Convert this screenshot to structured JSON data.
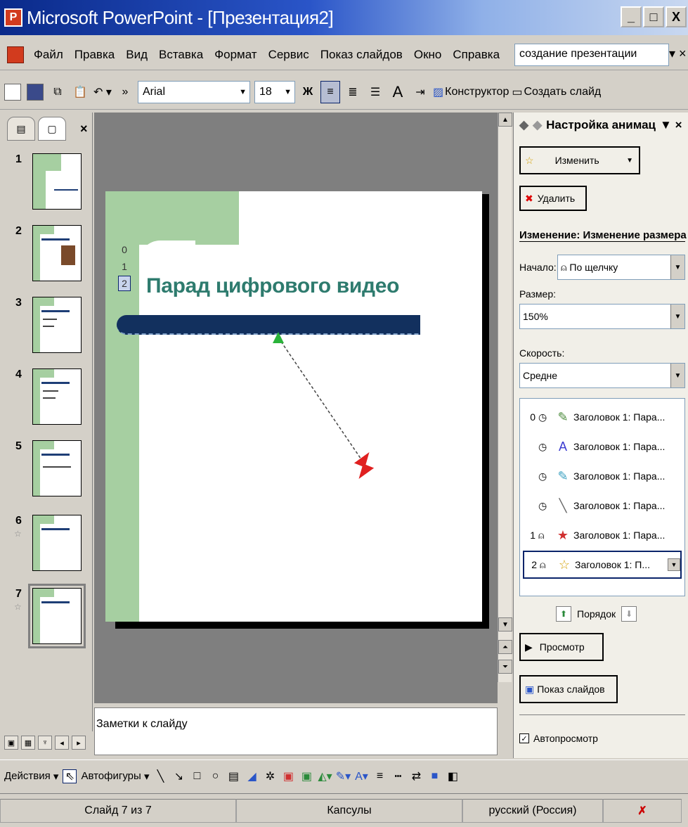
{
  "titlebar": {
    "title": "Microsoft PowerPoint - [Презентация2]",
    "minimize": "_",
    "maximize": "□",
    "close": "X"
  },
  "menu": {
    "items": [
      "Файл",
      "Правка",
      "Вид",
      "Вставка",
      "Формат",
      "Сервис",
      "Показ слайдов",
      "Окно",
      "Справка"
    ],
    "help_box": "создание презентации",
    "help_close": "▾ ×"
  },
  "toolbar": {
    "font": "Arial",
    "size": "18",
    "bold": "Ж",
    "designer": "Конструктор",
    "new_slide": "Создать слайд"
  },
  "slides_pane": {
    "thumbnails": [
      {
        "num": "1"
      },
      {
        "num": "2"
      },
      {
        "num": "3"
      },
      {
        "num": "4"
      },
      {
        "num": "5"
      },
      {
        "num": "6"
      },
      {
        "num": "7"
      }
    ]
  },
  "slide": {
    "title": "Парад цифрового видео",
    "anim_tags": [
      "0",
      "1",
      "2"
    ]
  },
  "notes": {
    "placeholder": "Заметки к слайду"
  },
  "task_pane": {
    "title": "Настройка анимац",
    "change_button": "Изменить",
    "delete_button": "Удалить",
    "effect_heading": "Изменение: Изменение размера",
    "start_label": "Начало:",
    "start_value": "По щелчку",
    "size_label": "Размер:",
    "size_value": "150%",
    "speed_label": "Скорость:",
    "speed_value": "Средне",
    "anim_items": [
      {
        "num": "0",
        "trigger": "clock",
        "text": "Заголовок 1: Пара..."
      },
      {
        "num": "",
        "trigger": "clock",
        "text": "Заголовок 1: Пара..."
      },
      {
        "num": "",
        "trigger": "clock",
        "text": "Заголовок 1: Пара..."
      },
      {
        "num": "",
        "trigger": "clock",
        "text": "Заголовок 1: Пара..."
      },
      {
        "num": "1",
        "trigger": "click",
        "text": "Заголовок 1: Пара..."
      },
      {
        "num": "2",
        "trigger": "click",
        "text": "Заголовок 1: П..."
      }
    ],
    "order_label": "Порядок",
    "preview_button": "Просмотр",
    "slideshow_button": "Показ слайдов",
    "autopreview_label": "Автопросмотр",
    "autopreview_checked": true
  },
  "drawing": {
    "actions": "Действия",
    "autoshapes": "Автофигуры"
  },
  "status": {
    "slide": "Слайд 7 из 7",
    "design": "Капсулы",
    "language": "русский (Россия)"
  }
}
